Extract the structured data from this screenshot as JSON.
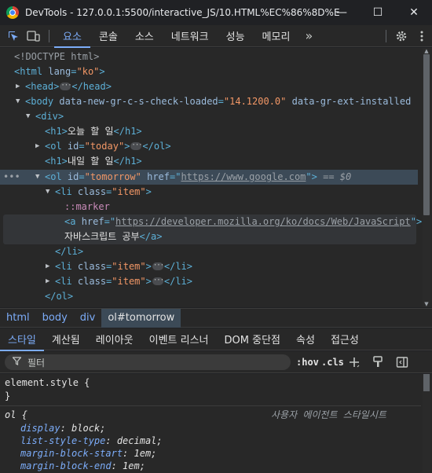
{
  "window": {
    "title": "DevTools - 127.0.0.1:5500/interactive_JS/10.HTML%EC%86%8D%EC%...",
    "minimize_glyph": "—",
    "maximize_glyph": "☐",
    "close_glyph": "✕"
  },
  "toolbar": {
    "inspect_icon": "inspect-element-icon",
    "device_icon": "device-toolbar-icon",
    "tabs": [
      {
        "label": "요소",
        "active": true
      },
      {
        "label": "콘솔"
      },
      {
        "label": "소스"
      },
      {
        "label": "네트워크"
      },
      {
        "label": "성능"
      },
      {
        "label": "메모리"
      }
    ],
    "more_tabs_glyph": "»",
    "settings_icon": "gear-icon",
    "menu_icon": "more-vertical-icon"
  },
  "dom": {
    "doctype": "<!DOCTYPE html>",
    "html_open": "<html",
    "html_lang_attr": "lang",
    "html_lang_val": "\"ko\"",
    "head_open": "<head>",
    "head_close": "</head>",
    "body_open": "<body",
    "body_attr1": "data-new-gr-c-s-check-loaded",
    "body_val1": "\"14.1200.0\"",
    "body_attr2": "data-gr-ext-installed",
    "div_open": "<div>",
    "h1_open": "<h1>",
    "h1_text_1": "오늘 할 일",
    "h1_close": "</h1>",
    "ol_today_open": "<ol",
    "ol_attr_id": "id",
    "ol_today_val": "\"today\"",
    "ol_close": "</ol>",
    "h1_text_2": "내일 할 일",
    "ol_tomorrow_val": "\"tomorrow\"",
    "href_attr": "href",
    "google_url": "https://www.google.com",
    "dollar0": "== $0",
    "li_open": "<li",
    "class_attr": "class",
    "item_val": "\"item\"",
    "marker": "::marker",
    "a_open": "<a",
    "mdn_url": "https://developer.mozilla.org/ko/docs/Web/JavaScript",
    "a_text": "자바스크립트 공부",
    "a_close": "</a>",
    "li_close": "</li>",
    "row_more": "•••"
  },
  "breadcrumb": [
    {
      "label": "html"
    },
    {
      "label": "body"
    },
    {
      "label": "div"
    },
    {
      "label": "ol#tomorrow",
      "active": true
    }
  ],
  "subtabs": [
    {
      "label": "스타일",
      "active": true
    },
    {
      "label": "계산됨"
    },
    {
      "label": "레이아웃"
    },
    {
      "label": "이벤트 리스너"
    },
    {
      "label": "DOM 중단점"
    },
    {
      "label": "속성"
    },
    {
      "label": "접근성"
    }
  ],
  "filter": {
    "placeholder": "필터",
    "hov": ":hov",
    "cls": ".cls",
    "add_icon": "plus-icon",
    "paint_icon": "paint-brush-icon",
    "sidebar_icon": "toggle-sidebar-icon"
  },
  "styles": {
    "element_style": "element.style {",
    "close_brace": "}",
    "ol_selector": "ol {",
    "ua_label": "사용자 에이전트 스타일시트",
    "props": [
      {
        "name": "display",
        "value": "block;"
      },
      {
        "name": "list-style-type",
        "value": "decimal;"
      },
      {
        "name": "margin-block-start",
        "value": "1em;"
      },
      {
        "name": "margin-block-end",
        "value": "1em;"
      }
    ]
  },
  "colors": {
    "accent": "#7cacf8",
    "tag": "#5db0d7",
    "attr_value": "#f29766",
    "selected_row": "#3c4a57"
  }
}
